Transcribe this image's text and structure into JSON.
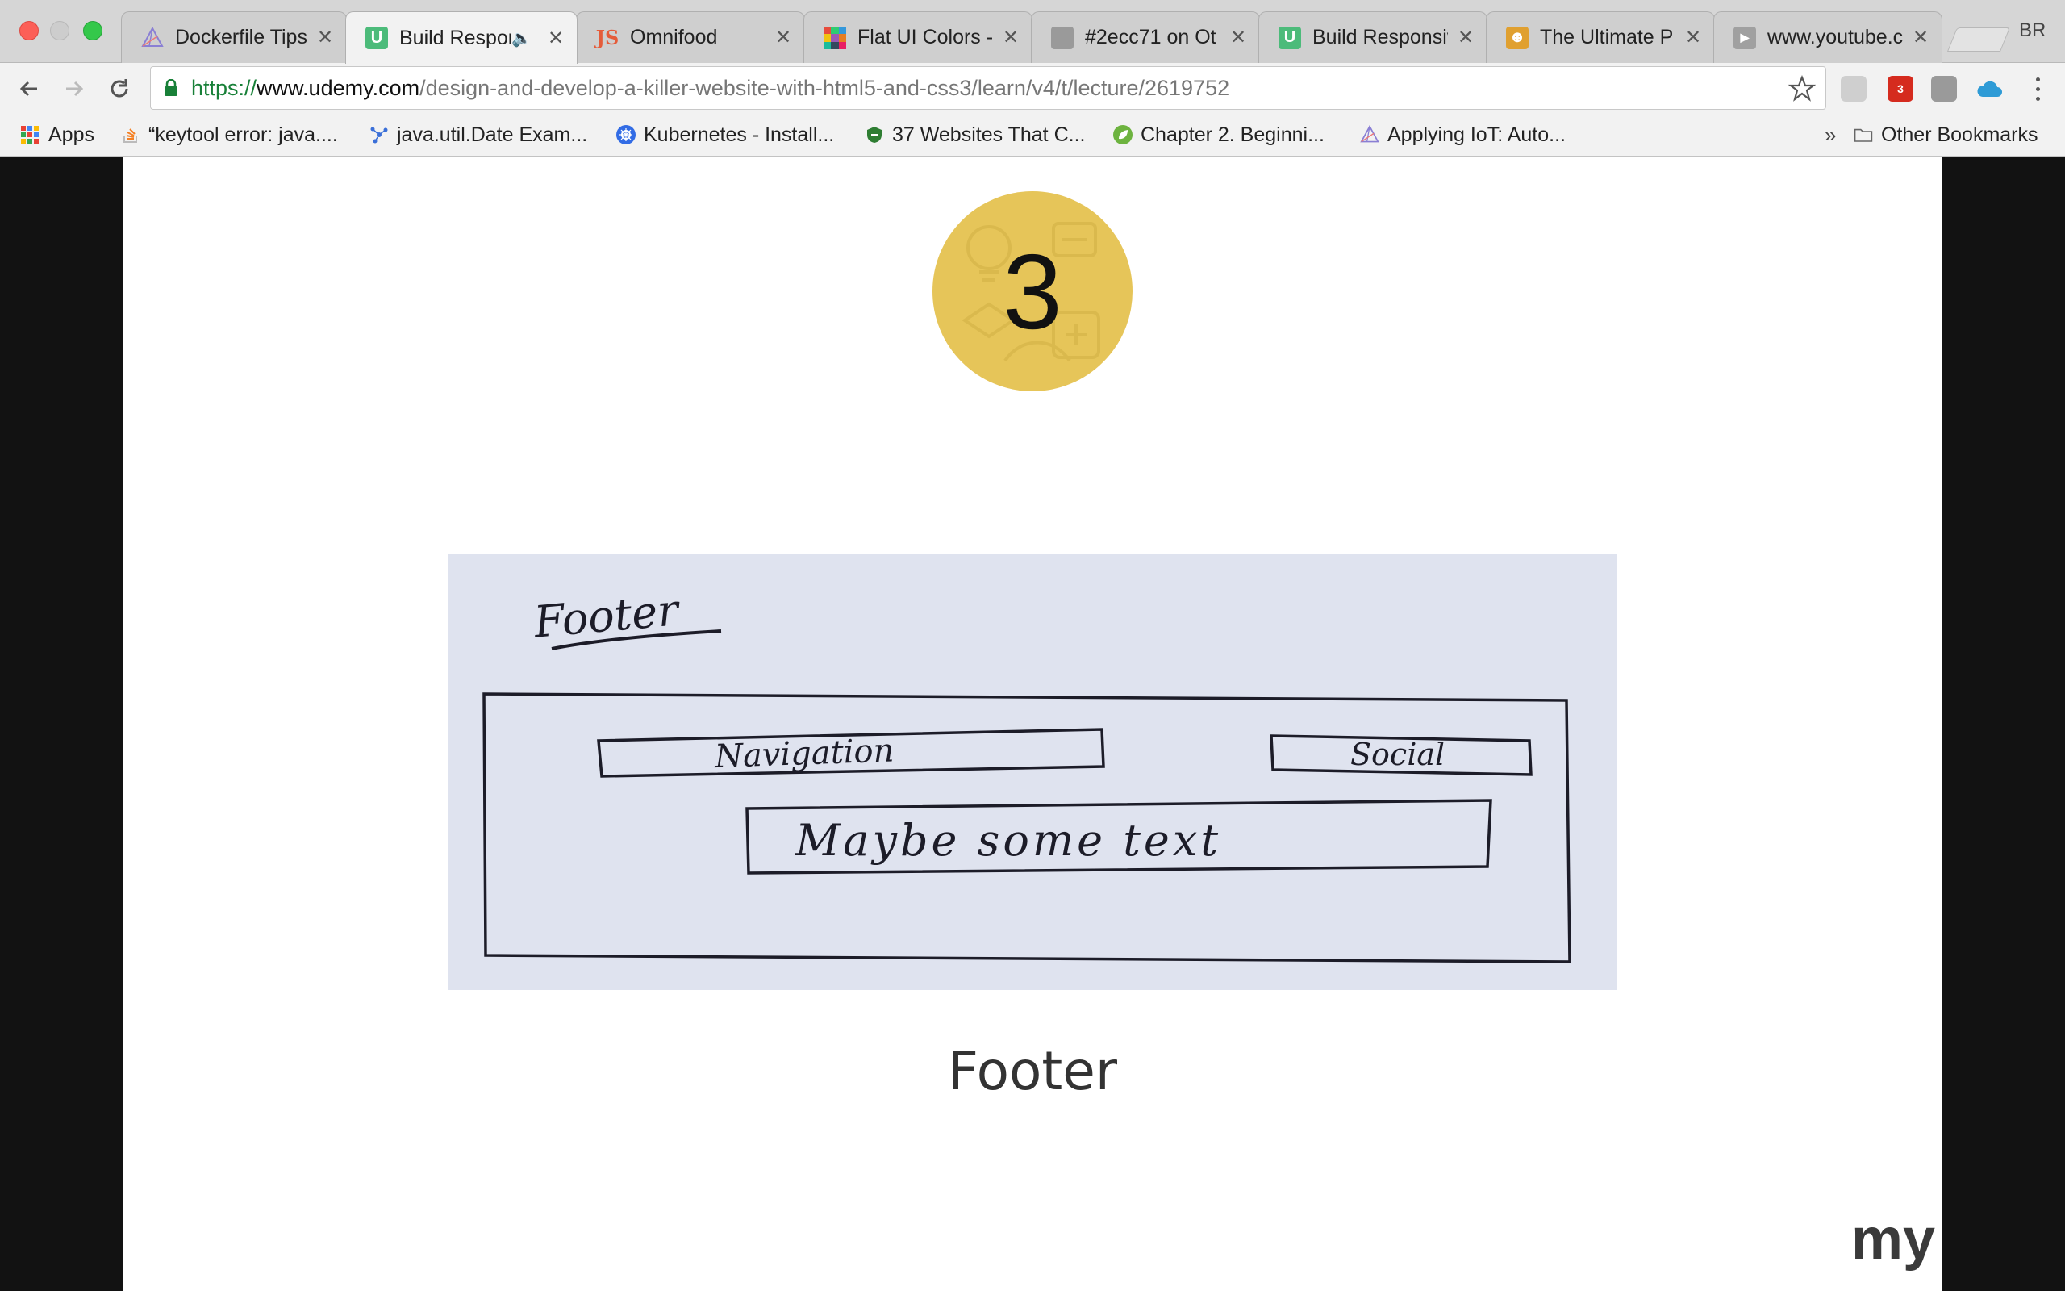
{
  "browser": {
    "tabs": [
      {
        "title": "Dockerfile Tips",
        "favicon": "wireframe-globe-icon",
        "color": "#8a7fd4",
        "active": false,
        "audio": false
      },
      {
        "title": "Build Respon",
        "favicon": "udemy-icon",
        "color": "#4cbb7a",
        "active": true,
        "audio": true
      },
      {
        "title": "Omnifood",
        "favicon": "js-icon",
        "color": "#e55c3a",
        "active": false,
        "audio": false
      },
      {
        "title": "Flat UI Colors -",
        "favicon": "color-grid-icon",
        "color": "#e74c3c",
        "active": false,
        "audio": false
      },
      {
        "title": "#2ecc71 on Ot",
        "favicon": "page-icon",
        "color": "#9a9a9a",
        "active": false,
        "audio": false
      },
      {
        "title": "Build Responsiv",
        "favicon": "udemy-icon",
        "color": "#4cbb7a",
        "active": false,
        "audio": false
      },
      {
        "title": "The Ultimate P",
        "favicon": "character-icon",
        "color": "#e0a030",
        "active": false,
        "audio": false
      },
      {
        "title": "www.youtube.c",
        "favicon": "youtube-icon",
        "color": "#a0a0a0",
        "active": false,
        "audio": false
      }
    ],
    "profile_label": "BR",
    "url": {
      "scheme": "https://",
      "host": "www.udemy.com",
      "path": "/design-and-develop-a-killer-website-with-html5-and-css3/learn/v4/t/lecture/2619752"
    },
    "extensions": [
      {
        "name": "incognito-ext-icon",
        "color": "#cfcfcf",
        "glyph": ""
      },
      {
        "name": "adblock-ext-icon",
        "color": "#d52b1e",
        "glyph": "3"
      },
      {
        "name": "white-ext-icon",
        "color": "#9a9a9a",
        "glyph": ""
      },
      {
        "name": "cloud-ext-icon",
        "color": "#2e9bd6",
        "glyph": ""
      }
    ],
    "bookmarks": [
      {
        "label": "Apps",
        "icon": "apps-grid-icon"
      },
      {
        "label": "“keytool error: java....",
        "icon": "stackoverflow-icon"
      },
      {
        "label": "java.util.Date Exam...",
        "icon": "molecule-icon"
      },
      {
        "label": "Kubernetes - Install...",
        "icon": "kubernetes-icon"
      },
      {
        "label": "37 Websites That C...",
        "icon": "shield-icon"
      },
      {
        "label": "Chapter 2. Beginni...",
        "icon": "spring-leaf-icon"
      },
      {
        "label": "Applying IoT: Auto...",
        "icon": "wireframe-globe-icon"
      }
    ],
    "bookmarks_overflow": "»",
    "other_bookmarks": "Other Bookmarks"
  },
  "slide": {
    "step_number": "3",
    "sketch_labels": {
      "heading": "Footer",
      "navigation": "Navigation",
      "social": "Social",
      "text_box": "Maybe some text"
    },
    "caption": "Footer",
    "watermark": "my"
  }
}
